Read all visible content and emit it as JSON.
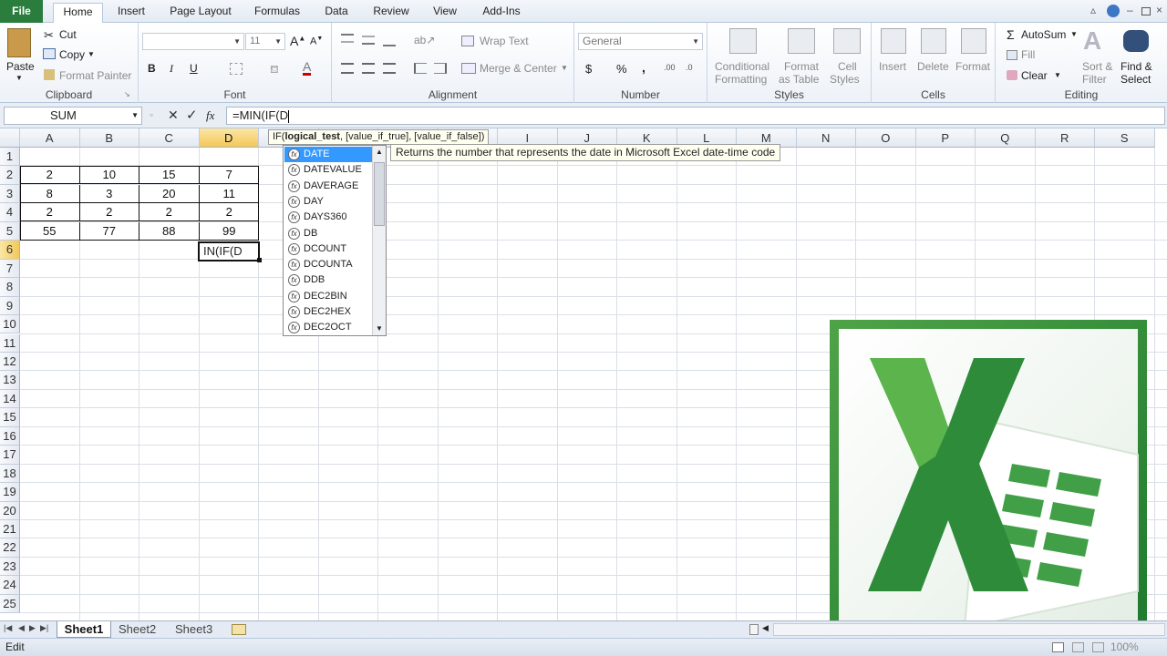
{
  "tabs": [
    "File",
    "Home",
    "Insert",
    "Page Layout",
    "Formulas",
    "Data",
    "Review",
    "View",
    "Add-Ins"
  ],
  "clipboard": {
    "paste": "Paste",
    "cut": "Cut",
    "copy": "Copy",
    "format_painter": "Format Painter",
    "label": "Clipboard"
  },
  "font": {
    "size": "11",
    "bold": "B",
    "italic": "I",
    "underline": "U",
    "label": "Font"
  },
  "alignment": {
    "wrap": "Wrap Text",
    "merge": "Merge & Center",
    "label": "Alignment"
  },
  "number": {
    "format": "General",
    "currency": "$",
    "percent": "%",
    "comma": ",",
    "label": "Number"
  },
  "styles": {
    "conditional_1": "Conditional",
    "conditional_2": "Formatting",
    "format_1": "Format",
    "format_2": "as Table",
    "cell_1": "Cell",
    "cell_2": "Styles",
    "label": "Styles"
  },
  "cells": {
    "insert": "Insert",
    "delete": "Delete",
    "format": "Format",
    "label": "Cells"
  },
  "editing": {
    "autosum": "AutoSum",
    "fill": "Fill",
    "clear": "Clear",
    "sort_1": "Sort &",
    "sort_2": "Filter",
    "find_1": "Find &",
    "find_2": "Select",
    "label": "Editing"
  },
  "formula_bar": {
    "name_box": "SUM",
    "cancel": "✕",
    "enter": "✓",
    "fx": "fx",
    "formula": "=MIN(IF(D"
  },
  "columns": [
    "A",
    "B",
    "C",
    "D",
    "E",
    "F",
    "G",
    "H",
    "I",
    "J",
    "K",
    "L",
    "M",
    "N",
    "O",
    "P",
    "Q",
    "R",
    "S"
  ],
  "rows": [
    "1",
    "2",
    "3",
    "4",
    "5",
    "6",
    "7",
    "8",
    "9",
    "10",
    "11",
    "12",
    "13",
    "14",
    "15",
    "16",
    "17",
    "18",
    "19",
    "20",
    "21",
    "22",
    "23",
    "24",
    "25"
  ],
  "table": [
    [
      "2",
      "10",
      "15",
      "7"
    ],
    [
      "8",
      "3",
      "20",
      "11"
    ],
    [
      "2",
      "2",
      "2",
      "2"
    ],
    [
      "55",
      "77",
      "88",
      "99"
    ]
  ],
  "active_cell": {
    "text": "IN(IF(D"
  },
  "syntax_tip": {
    "func": "IF(",
    "arg1": "logical_test",
    "rest": ", [value_if_true], [value_if_false])"
  },
  "autocomplete": [
    "DATE",
    "DATEVALUE",
    "DAVERAGE",
    "DAY",
    "DAYS360",
    "DB",
    "DCOUNT",
    "DCOUNTA",
    "DDB",
    "DEC2BIN",
    "DEC2HEX",
    "DEC2OCT"
  ],
  "description": "Returns the number that represents the date in Microsoft Excel date-time code",
  "sheets": [
    "Sheet1",
    "Sheet2",
    "Sheet3"
  ],
  "status": {
    "mode": "Edit",
    "zoom": "100%"
  },
  "colors": {
    "file_tab": "#2a7d3d",
    "selected_header": "#f3c85a",
    "autocomplete_highlight": "#3399ff"
  }
}
